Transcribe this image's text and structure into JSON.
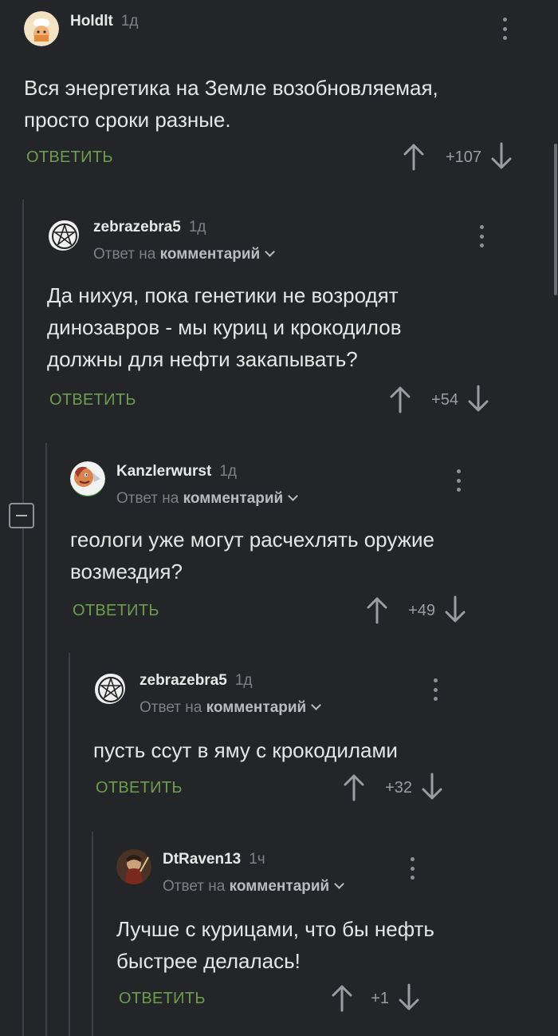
{
  "comments": [
    {
      "username": "Holdlt",
      "time": "1д",
      "reply_prefix": "",
      "reply_target": "",
      "text_lines": [
        "Вся энергетика на Земле возобновляемая,",
        "просто сроки разные."
      ],
      "reply_label": "ОТВЕТИТЬ",
      "score": "+107",
      "avatar": "cartoon-character-avatar"
    },
    {
      "username": "zebrazebra5",
      "time": "1д",
      "reply_prefix": "Ответ на",
      "reply_target": "комментарий",
      "text_lines": [
        "Да нихуя, пока генетики не возродят",
        "динозавров - мы куриц и крокодилов",
        "должны для нефти закапывать?"
      ],
      "reply_label": "ОТВЕТИТЬ",
      "score": "+54",
      "avatar": "pentagram-seal-avatar"
    },
    {
      "username": "Kanzlerwurst",
      "time": "1д",
      "reply_prefix": "Ответ на",
      "reply_target": "комментарий",
      "text_lines": [
        "геологи уже могут расчехлять оружие",
        "возмездия?"
      ],
      "reply_label": "ОТВЕТИТЬ",
      "score": "+49",
      "avatar": "cartoon-face-avatar"
    },
    {
      "username": "zebrazebra5",
      "time": "1д",
      "reply_prefix": "Ответ на",
      "reply_target": "комментарий",
      "text_lines": [
        "пусть ссут в яму с крокодилами"
      ],
      "reply_label": "ОТВЕТИТЬ",
      "score": "+32",
      "avatar": "pentagram-seal-avatar"
    },
    {
      "username": "DtRaven13",
      "time": "1ч",
      "reply_prefix": "Ответ на",
      "reply_target": "комментарий",
      "text_lines": [
        "Лучше с курицами, что бы нефть",
        "быстрее делалась!"
      ],
      "reply_label": "ОТВЕТИТЬ",
      "score": "+1",
      "avatar": "warrior-portrait-avatar"
    }
  ],
  "colors": {
    "background": "#232529",
    "reply_green": "#6b9e4d",
    "muted": "#7d8186"
  },
  "icons": {
    "upvote": "arrow-up-icon",
    "downvote": "arrow-down-icon",
    "more": "more-vertical-icon",
    "collapse": "minus-square-icon",
    "expand_reply": "chevron-down-icon"
  }
}
